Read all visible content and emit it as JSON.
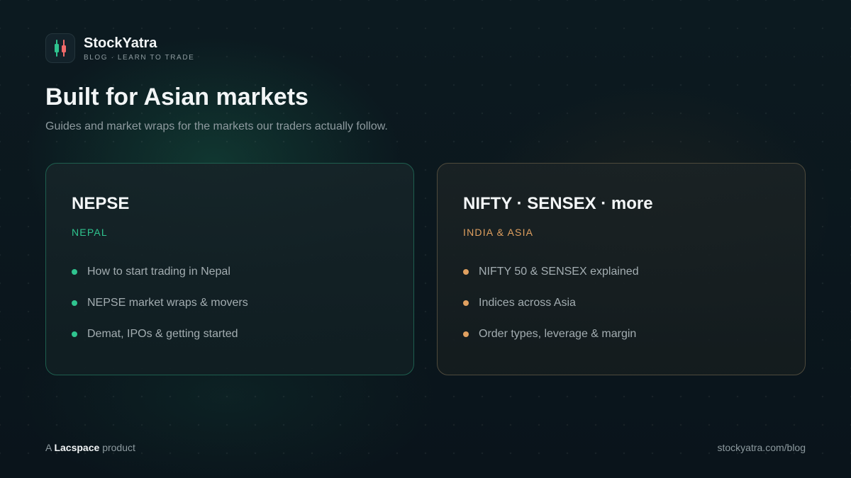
{
  "brand": {
    "name": "StockYatra",
    "tagline": "BLOG · LEARN TO TRADE",
    "logo_icon": "candlestick-icon",
    "colors": {
      "up": "#2fc48f",
      "down": "#f06a6a"
    }
  },
  "hero": {
    "title": "Built for Asian markets",
    "subtitle": "Guides and market wraps for the markets our traders actually follow."
  },
  "cards": [
    {
      "title": "NEPSE",
      "region": "NEPAL",
      "accent": "#2fc48f",
      "items": [
        "How to start trading in Nepal",
        "NEPSE market wraps & movers",
        "Demat, IPOs & getting started"
      ]
    },
    {
      "title": "NIFTY · SENSEX · more",
      "region": "INDIA & ASIA",
      "accent": "#e0a060",
      "items": [
        "NIFTY 50 & SENSEX explained",
        "Indices across Asia",
        "Order types, leverage & margin"
      ]
    }
  ],
  "footer": {
    "prefix": "A",
    "company": "Lacspace",
    "suffix": "product",
    "url": "stockyatra.com/blog"
  }
}
